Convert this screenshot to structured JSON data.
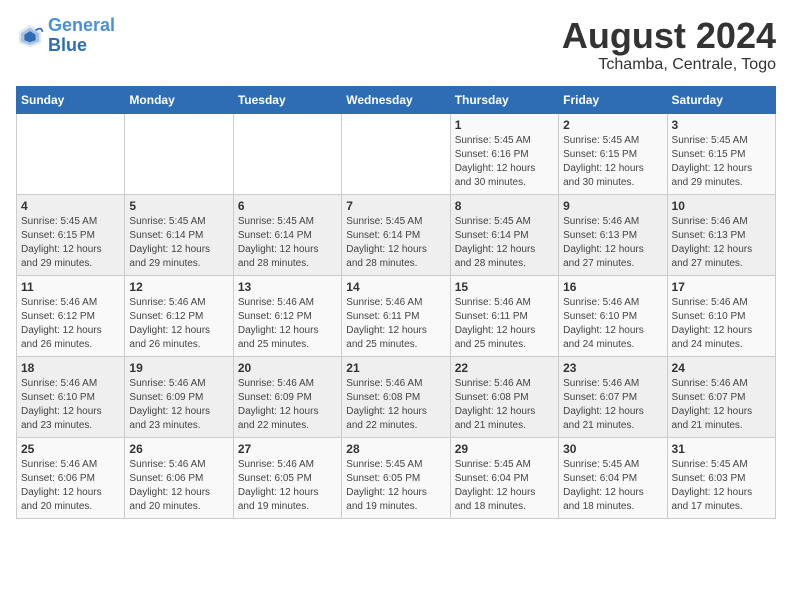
{
  "header": {
    "logo_line1": "General",
    "logo_line2": "Blue",
    "title": "August 2024",
    "subtitle": "Tchamba, Centrale, Togo"
  },
  "weekdays": [
    "Sunday",
    "Monday",
    "Tuesday",
    "Wednesday",
    "Thursday",
    "Friday",
    "Saturday"
  ],
  "weeks": [
    [
      {
        "day": "",
        "info": ""
      },
      {
        "day": "",
        "info": ""
      },
      {
        "day": "",
        "info": ""
      },
      {
        "day": "",
        "info": ""
      },
      {
        "day": "1",
        "info": "Sunrise: 5:45 AM\nSunset: 6:16 PM\nDaylight: 12 hours\nand 30 minutes."
      },
      {
        "day": "2",
        "info": "Sunrise: 5:45 AM\nSunset: 6:15 PM\nDaylight: 12 hours\nand 30 minutes."
      },
      {
        "day": "3",
        "info": "Sunrise: 5:45 AM\nSunset: 6:15 PM\nDaylight: 12 hours\nand 29 minutes."
      }
    ],
    [
      {
        "day": "4",
        "info": "Sunrise: 5:45 AM\nSunset: 6:15 PM\nDaylight: 12 hours\nand 29 minutes."
      },
      {
        "day": "5",
        "info": "Sunrise: 5:45 AM\nSunset: 6:14 PM\nDaylight: 12 hours\nand 29 minutes."
      },
      {
        "day": "6",
        "info": "Sunrise: 5:45 AM\nSunset: 6:14 PM\nDaylight: 12 hours\nand 28 minutes."
      },
      {
        "day": "7",
        "info": "Sunrise: 5:45 AM\nSunset: 6:14 PM\nDaylight: 12 hours\nand 28 minutes."
      },
      {
        "day": "8",
        "info": "Sunrise: 5:45 AM\nSunset: 6:14 PM\nDaylight: 12 hours\nand 28 minutes."
      },
      {
        "day": "9",
        "info": "Sunrise: 5:46 AM\nSunset: 6:13 PM\nDaylight: 12 hours\nand 27 minutes."
      },
      {
        "day": "10",
        "info": "Sunrise: 5:46 AM\nSunset: 6:13 PM\nDaylight: 12 hours\nand 27 minutes."
      }
    ],
    [
      {
        "day": "11",
        "info": "Sunrise: 5:46 AM\nSunset: 6:12 PM\nDaylight: 12 hours\nand 26 minutes."
      },
      {
        "day": "12",
        "info": "Sunrise: 5:46 AM\nSunset: 6:12 PM\nDaylight: 12 hours\nand 26 minutes."
      },
      {
        "day": "13",
        "info": "Sunrise: 5:46 AM\nSunset: 6:12 PM\nDaylight: 12 hours\nand 25 minutes."
      },
      {
        "day": "14",
        "info": "Sunrise: 5:46 AM\nSunset: 6:11 PM\nDaylight: 12 hours\nand 25 minutes."
      },
      {
        "day": "15",
        "info": "Sunrise: 5:46 AM\nSunset: 6:11 PM\nDaylight: 12 hours\nand 25 minutes."
      },
      {
        "day": "16",
        "info": "Sunrise: 5:46 AM\nSunset: 6:10 PM\nDaylight: 12 hours\nand 24 minutes."
      },
      {
        "day": "17",
        "info": "Sunrise: 5:46 AM\nSunset: 6:10 PM\nDaylight: 12 hours\nand 24 minutes."
      }
    ],
    [
      {
        "day": "18",
        "info": "Sunrise: 5:46 AM\nSunset: 6:10 PM\nDaylight: 12 hours\nand 23 minutes."
      },
      {
        "day": "19",
        "info": "Sunrise: 5:46 AM\nSunset: 6:09 PM\nDaylight: 12 hours\nand 23 minutes."
      },
      {
        "day": "20",
        "info": "Sunrise: 5:46 AM\nSunset: 6:09 PM\nDaylight: 12 hours\nand 22 minutes."
      },
      {
        "day": "21",
        "info": "Sunrise: 5:46 AM\nSunset: 6:08 PM\nDaylight: 12 hours\nand 22 minutes."
      },
      {
        "day": "22",
        "info": "Sunrise: 5:46 AM\nSunset: 6:08 PM\nDaylight: 12 hours\nand 21 minutes."
      },
      {
        "day": "23",
        "info": "Sunrise: 5:46 AM\nSunset: 6:07 PM\nDaylight: 12 hours\nand 21 minutes."
      },
      {
        "day": "24",
        "info": "Sunrise: 5:46 AM\nSunset: 6:07 PM\nDaylight: 12 hours\nand 21 minutes."
      }
    ],
    [
      {
        "day": "25",
        "info": "Sunrise: 5:46 AM\nSunset: 6:06 PM\nDaylight: 12 hours\nand 20 minutes."
      },
      {
        "day": "26",
        "info": "Sunrise: 5:46 AM\nSunset: 6:06 PM\nDaylight: 12 hours\nand 20 minutes."
      },
      {
        "day": "27",
        "info": "Sunrise: 5:46 AM\nSunset: 6:05 PM\nDaylight: 12 hours\nand 19 minutes."
      },
      {
        "day": "28",
        "info": "Sunrise: 5:45 AM\nSunset: 6:05 PM\nDaylight: 12 hours\nand 19 minutes."
      },
      {
        "day": "29",
        "info": "Sunrise: 5:45 AM\nSunset: 6:04 PM\nDaylight: 12 hours\nand 18 minutes."
      },
      {
        "day": "30",
        "info": "Sunrise: 5:45 AM\nSunset: 6:04 PM\nDaylight: 12 hours\nand 18 minutes."
      },
      {
        "day": "31",
        "info": "Sunrise: 5:45 AM\nSunset: 6:03 PM\nDaylight: 12 hours\nand 17 minutes."
      }
    ]
  ]
}
